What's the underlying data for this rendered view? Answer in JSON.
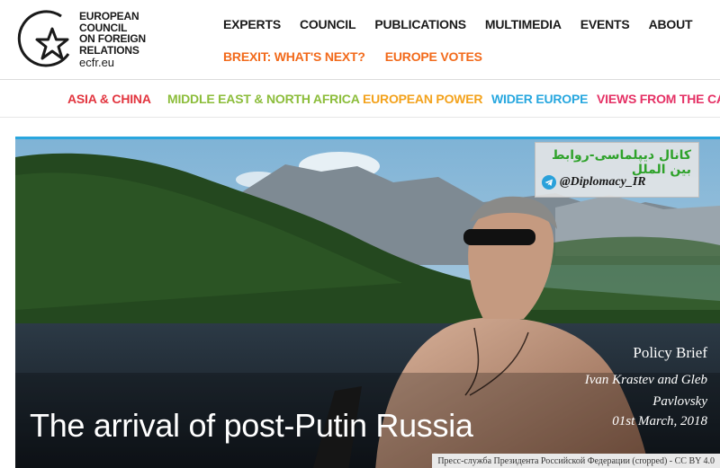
{
  "site": {
    "logo_lines": [
      "EUROPEAN",
      "COUNCIL",
      "ON FOREIGN",
      "RELATIONS"
    ],
    "logo_url": "ecfr.eu"
  },
  "topnav": [
    "EXPERTS",
    "COUNCIL",
    "PUBLICATIONS",
    "MULTIMEDIA",
    "EVENTS",
    "ABOUT"
  ],
  "subnav": [
    "BREXIT: WHAT'S NEXT?",
    "EUROPE VOTES"
  ],
  "categories": [
    {
      "label": "ASIA & CHINA",
      "color": "#e2353f"
    },
    {
      "label": "MIDDLE EAST & NORTH AFRICA",
      "color": "#8cbd3b"
    },
    {
      "label": "EUROPEAN POWER",
      "color": "#f3a21c"
    },
    {
      "label": "WIDER EUROPE",
      "color": "#27a7df"
    },
    {
      "label": "VIEWS FROM THE CAP",
      "color": "#e53165"
    }
  ],
  "hero": {
    "type": "Policy Brief",
    "authors_line1": "Ivan Krastev and Gleb",
    "authors_line2": "Pavlovsky",
    "date": "01st March, 2018",
    "title": "The arrival of post-Putin Russia",
    "credit": "Пресс-служба Президента Российской Федерации (cropped) - CC BY 4.0"
  },
  "watermark": {
    "channel": "کانال دیپلماسی-روابط بین الملل",
    "handle": "@Diplomacy_IR"
  },
  "colors": {
    "accent_orange": "#f26a1b",
    "hero_border": "#2aa6de"
  }
}
